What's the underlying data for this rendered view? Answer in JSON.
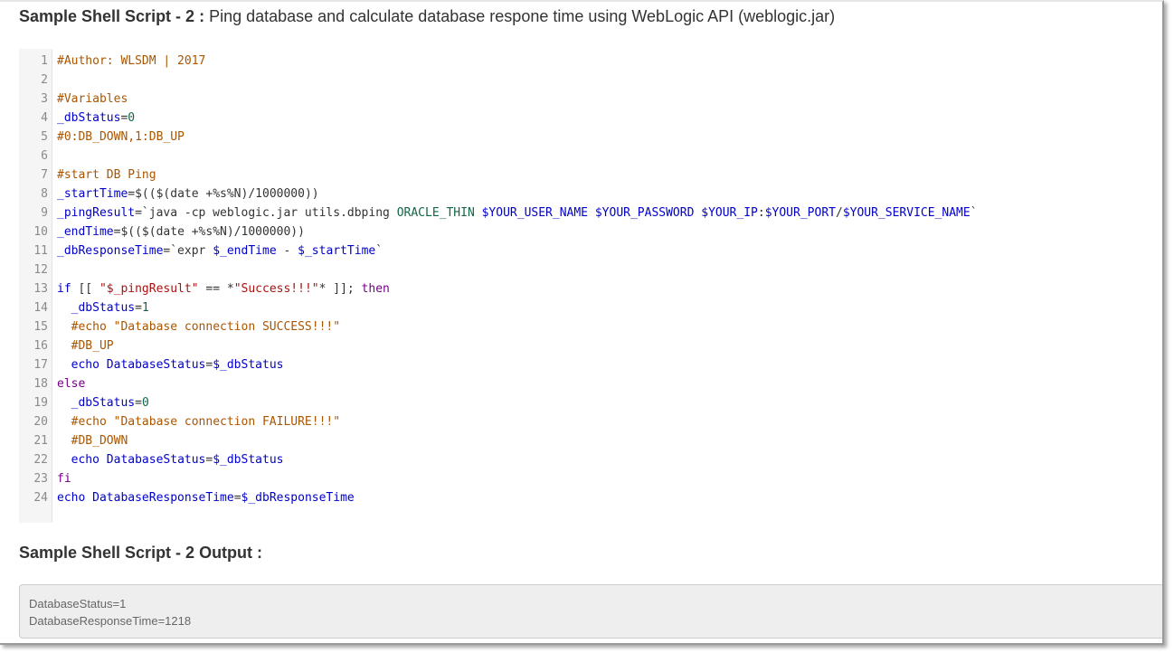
{
  "heading_1": {
    "bold": "Sample Shell Script - 2 :",
    "rest": " Ping database and calculate database respone time using WebLogic API (weblogic.jar)"
  },
  "code": {
    "lines": [
      {
        "n": "1",
        "t": [
          {
            "c": "comment",
            "s": "#Author: WLSDM | 2017"
          }
        ]
      },
      {
        "n": "2",
        "t": []
      },
      {
        "n": "3",
        "t": [
          {
            "c": "comment",
            "s": "#Variables"
          }
        ]
      },
      {
        "n": "4",
        "t": [
          {
            "c": "var",
            "s": "_dbStatus"
          },
          {
            "c": "plain",
            "s": "="
          },
          {
            "c": "num",
            "s": "0"
          }
        ]
      },
      {
        "n": "5",
        "t": [
          {
            "c": "comment",
            "s": "#0:DB_DOWN,1:DB_UP"
          }
        ]
      },
      {
        "n": "6",
        "t": []
      },
      {
        "n": "7",
        "t": [
          {
            "c": "comment",
            "s": "#start DB Ping"
          }
        ]
      },
      {
        "n": "8",
        "t": [
          {
            "c": "var",
            "s": "_startTime"
          },
          {
            "c": "plain",
            "s": "=$(($(date +%s%N)/1000000))"
          }
        ]
      },
      {
        "n": "9",
        "t": [
          {
            "c": "var",
            "s": "_pingResult"
          },
          {
            "c": "plain",
            "s": "=`java -cp weblogic.jar utils.dbping "
          },
          {
            "c": "num",
            "s": "ORACLE_THIN"
          },
          {
            "c": "plain",
            "s": " "
          },
          {
            "c": "var",
            "s": "$YOUR_USER_NAME"
          },
          {
            "c": "plain",
            "s": " "
          },
          {
            "c": "var",
            "s": "$YOUR_PASSWORD"
          },
          {
            "c": "plain",
            "s": " "
          },
          {
            "c": "var",
            "s": "$YOUR_IP"
          },
          {
            "c": "plain",
            "s": ":"
          },
          {
            "c": "var",
            "s": "$YOUR_PORT"
          },
          {
            "c": "plain",
            "s": "/"
          },
          {
            "c": "var",
            "s": "$YOUR_SERVICE_NAME"
          },
          {
            "c": "plain",
            "s": "`"
          }
        ]
      },
      {
        "n": "10",
        "t": [
          {
            "c": "var",
            "s": "_endTime"
          },
          {
            "c": "plain",
            "s": "=$(($(date +%s%N)/1000000))"
          }
        ]
      },
      {
        "n": "11",
        "t": [
          {
            "c": "var",
            "s": "_dbResponseTime"
          },
          {
            "c": "plain",
            "s": "=`expr "
          },
          {
            "c": "var",
            "s": "$_endTime"
          },
          {
            "c": "plain",
            "s": " - "
          },
          {
            "c": "var",
            "s": "$_startTime"
          },
          {
            "c": "plain",
            "s": "`"
          }
        ]
      },
      {
        "n": "12",
        "t": []
      },
      {
        "n": "13",
        "t": [
          {
            "c": "var",
            "s": "if"
          },
          {
            "c": "plain",
            "s": " [[ "
          },
          {
            "c": "str",
            "s": "\"$_pingResult\""
          },
          {
            "c": "plain",
            "s": " == *"
          },
          {
            "c": "str",
            "s": "\"Success!!!\""
          },
          {
            "c": "plain",
            "s": "* ]]; "
          },
          {
            "c": "kw",
            "s": "then"
          }
        ]
      },
      {
        "n": "14",
        "t": [
          {
            "c": "plain",
            "s": "  "
          },
          {
            "c": "var",
            "s": "_dbStatus"
          },
          {
            "c": "plain",
            "s": "="
          },
          {
            "c": "num",
            "s": "1"
          }
        ]
      },
      {
        "n": "15",
        "t": [
          {
            "c": "plain",
            "s": "  "
          },
          {
            "c": "comment",
            "s": "#echo \"Database connection SUCCESS!!!\""
          }
        ]
      },
      {
        "n": "16",
        "t": [
          {
            "c": "plain",
            "s": "  "
          },
          {
            "c": "comment",
            "s": "#DB_UP"
          }
        ]
      },
      {
        "n": "17",
        "t": [
          {
            "c": "plain",
            "s": "  "
          },
          {
            "c": "var",
            "s": "echo"
          },
          {
            "c": "plain",
            "s": " "
          },
          {
            "c": "var",
            "s": "DatabaseStatus"
          },
          {
            "c": "plain",
            "s": "="
          },
          {
            "c": "var",
            "s": "$_dbStatus"
          }
        ]
      },
      {
        "n": "18",
        "t": [
          {
            "c": "kw",
            "s": "else"
          }
        ]
      },
      {
        "n": "19",
        "t": [
          {
            "c": "plain",
            "s": "  "
          },
          {
            "c": "var",
            "s": "_dbStatus"
          },
          {
            "c": "plain",
            "s": "="
          },
          {
            "c": "num",
            "s": "0"
          }
        ]
      },
      {
        "n": "20",
        "t": [
          {
            "c": "plain",
            "s": "  "
          },
          {
            "c": "comment",
            "s": "#echo \"Database connection FAILURE!!!\""
          }
        ]
      },
      {
        "n": "21",
        "t": [
          {
            "c": "plain",
            "s": "  "
          },
          {
            "c": "comment",
            "s": "#DB_DOWN"
          }
        ]
      },
      {
        "n": "22",
        "t": [
          {
            "c": "plain",
            "s": "  "
          },
          {
            "c": "var",
            "s": "echo"
          },
          {
            "c": "plain",
            "s": " "
          },
          {
            "c": "var",
            "s": "DatabaseStatus"
          },
          {
            "c": "plain",
            "s": "="
          },
          {
            "c": "var",
            "s": "$_dbStatus"
          }
        ]
      },
      {
        "n": "23",
        "t": [
          {
            "c": "kw",
            "s": "fi"
          }
        ]
      },
      {
        "n": "24",
        "t": [
          {
            "c": "var",
            "s": "echo"
          },
          {
            "c": "plain",
            "s": " "
          },
          {
            "c": "var",
            "s": "DatabaseResponseTime"
          },
          {
            "c": "plain",
            "s": "="
          },
          {
            "c": "var",
            "s": "$_dbResponseTime"
          }
        ]
      }
    ]
  },
  "heading_2": {
    "bold": "Sample Shell Script - 2 Output :"
  },
  "output": {
    "lines": [
      "DatabaseStatus=1",
      "DatabaseResponseTime=1218"
    ]
  }
}
